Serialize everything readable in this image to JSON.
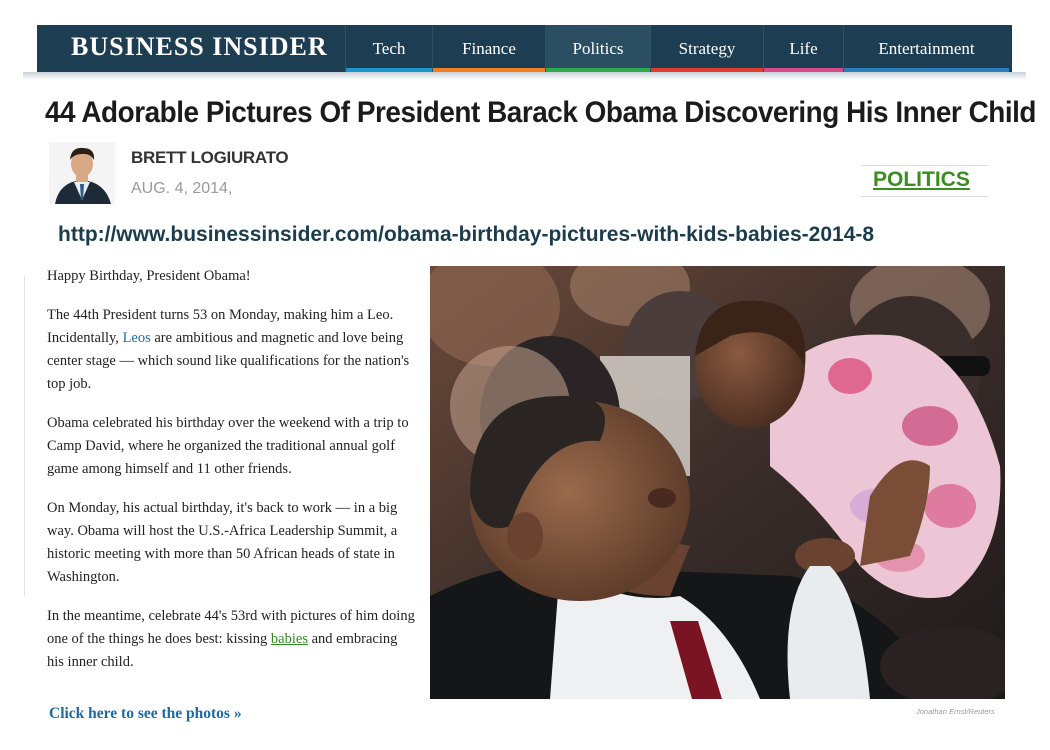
{
  "header": {
    "logo_text": "BUSINESS INSIDER",
    "nav": [
      {
        "label": "Tech",
        "color": "#1b94c8"
      },
      {
        "label": "Finance",
        "color": "#f57f20"
      },
      {
        "label": "Politics",
        "color": "#2eaa4a"
      },
      {
        "label": "Strategy",
        "color": "#e23a2e"
      },
      {
        "label": "Life",
        "color": "#d64a8e"
      },
      {
        "label": "Entertainment",
        "color": "#2a7fb8"
      }
    ],
    "active_tab": "Politics"
  },
  "article": {
    "headline": "44 Adorable Pictures Of President Barack Obama Discovering His Inner Child",
    "author": "BRETT LOGIURATO",
    "date": "AUG. 4, 2014,",
    "category": "POLITICS",
    "url": "http://www.businessinsider.com/obama-birthday-pictures-with-kids-babies-2014-8",
    "p1": "Happy Birthday, President Obama!",
    "p2_before": "The 44th President turns 53 on Monday, making him a Leo. Incidentally, ",
    "p2_link": "Leos",
    "p2_after": " are ambitious and magnetic and love being center stage — which sound like qualifications for the nation's top job.",
    "p3": "Obama celebrated his birthday over the weekend with a trip to Camp David, where he organized the traditional annual golf game among himself and 11 other friends.",
    "p4": "On Monday, his actual birthday, it's back to work — in a big way. Obama will host the U.S.-Africa Leadership Summit, a historic meeting with more than 50 African heads of state in Washington.",
    "p5_before": "In the meantime, celebrate 44's 53rd with pictures of him doing one of the things he does best: kissing ",
    "p5_link": "babies",
    "p5_after": " and embracing his inner child.",
    "cta": "Click here to see the photos »",
    "photo_credit": "Jonathan Ernst/Reuters"
  },
  "colors": {
    "navbar": "#1d3e52",
    "link_blue": "#1d6aa5",
    "category_green": "#3a8e1f"
  }
}
